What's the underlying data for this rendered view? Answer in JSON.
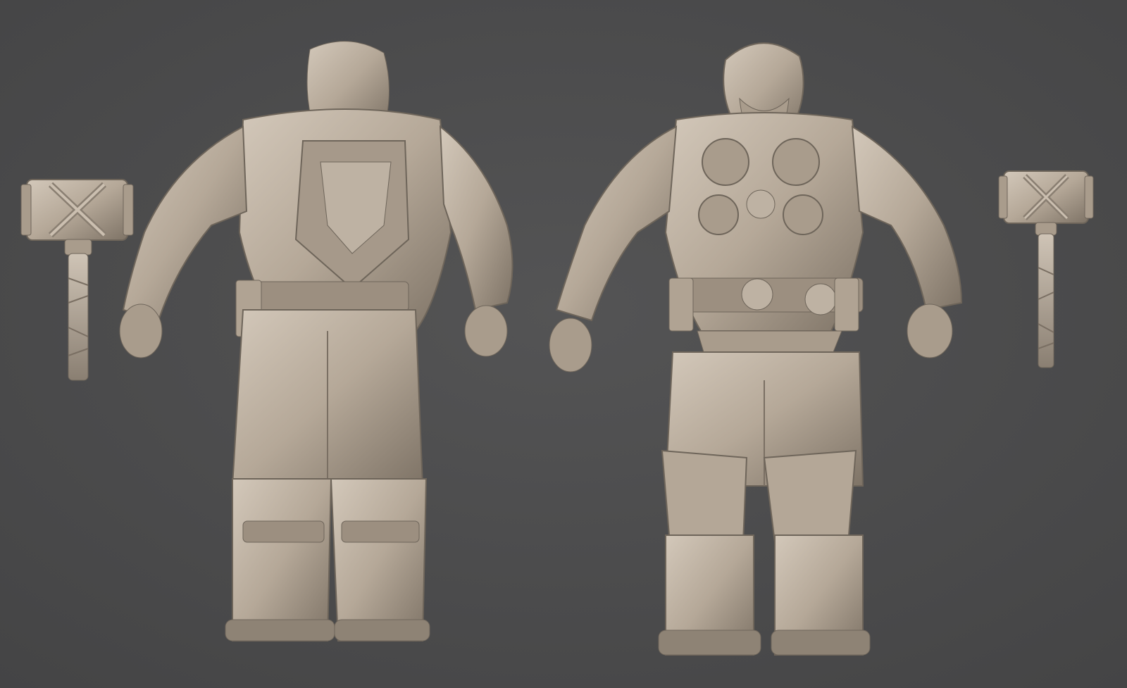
{
  "scene": {
    "background_color": "#4c4c4d",
    "clay_color": "#b8ab9b",
    "clay_shadow": "#7a6f63",
    "clay_highlight": "#d9cfc2",
    "objects": [
      {
        "name": "hammer-left",
        "label": ""
      },
      {
        "name": "character-back-view",
        "label": ""
      },
      {
        "name": "character-front-view",
        "label": ""
      },
      {
        "name": "hammer-right",
        "label": ""
      }
    ]
  }
}
